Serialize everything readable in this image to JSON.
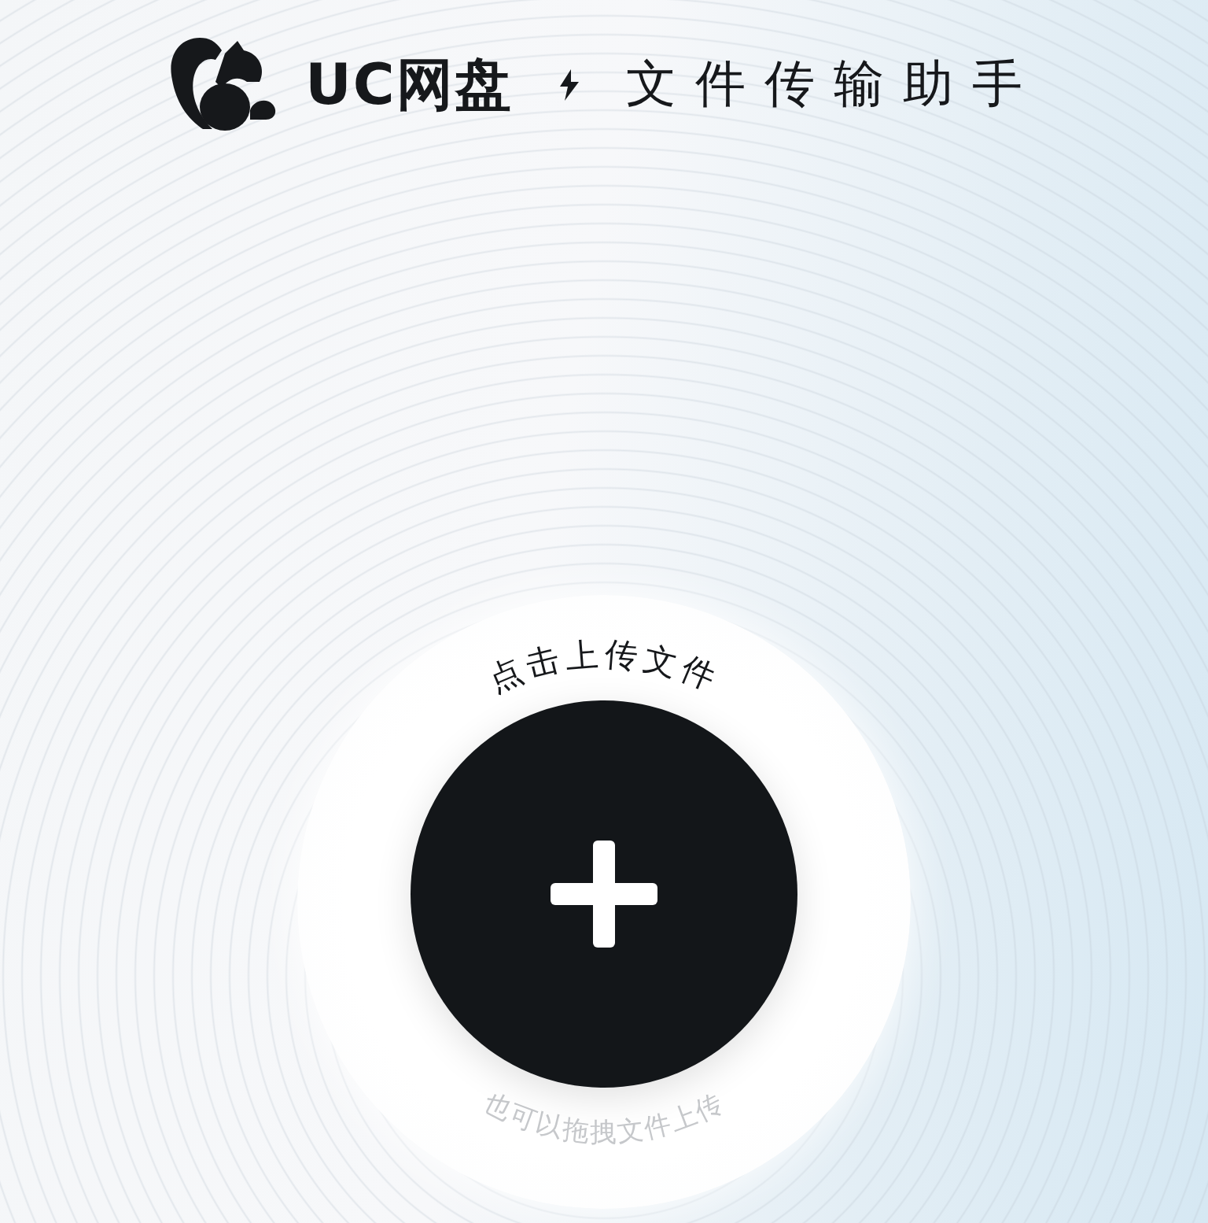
{
  "header": {
    "brand": "UC网盘",
    "subtitle": "文件传输助手"
  },
  "upload": {
    "label": "点击上传文件",
    "hint": "也可以拖拽文件上传"
  }
}
